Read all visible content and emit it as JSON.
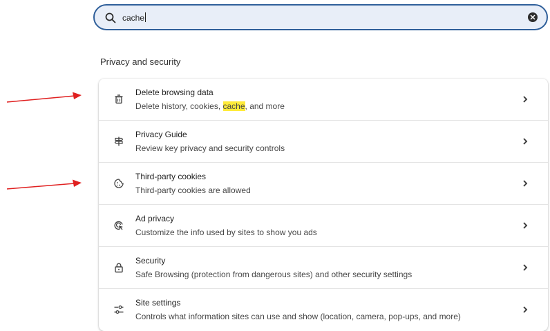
{
  "search": {
    "value": "cache",
    "icon": "search-icon",
    "clear_icon": "clear-icon"
  },
  "section": {
    "title": "Privacy and security"
  },
  "items": [
    {
      "icon": "trash-icon",
      "title": "Delete browsing data",
      "subtitle_before": "Delete history, cookies, ",
      "subtitle_highlight": "cache",
      "subtitle_after": ", and more"
    },
    {
      "icon": "compass-guide-icon",
      "title": "Privacy Guide",
      "subtitle": "Review key privacy and security controls"
    },
    {
      "icon": "cookie-icon",
      "title": "Third-party cookies",
      "subtitle": "Third-party cookies are allowed"
    },
    {
      "icon": "ad-privacy-icon",
      "title": "Ad privacy",
      "subtitle": "Customize the info used by sites to show you ads"
    },
    {
      "icon": "lock-icon",
      "title": "Security",
      "subtitle": "Safe Browsing (protection from dangerous sites) and other security settings"
    },
    {
      "icon": "sliders-icon",
      "title": "Site settings",
      "subtitle": "Controls what information sites can use and show (location, camera, pop-ups, and more)"
    }
  ],
  "colors": {
    "search_border": "#2f5f9a",
    "search_bg": "#e8eef8",
    "highlight": "#ffeb3b",
    "annotation_arrow": "#e02020"
  }
}
